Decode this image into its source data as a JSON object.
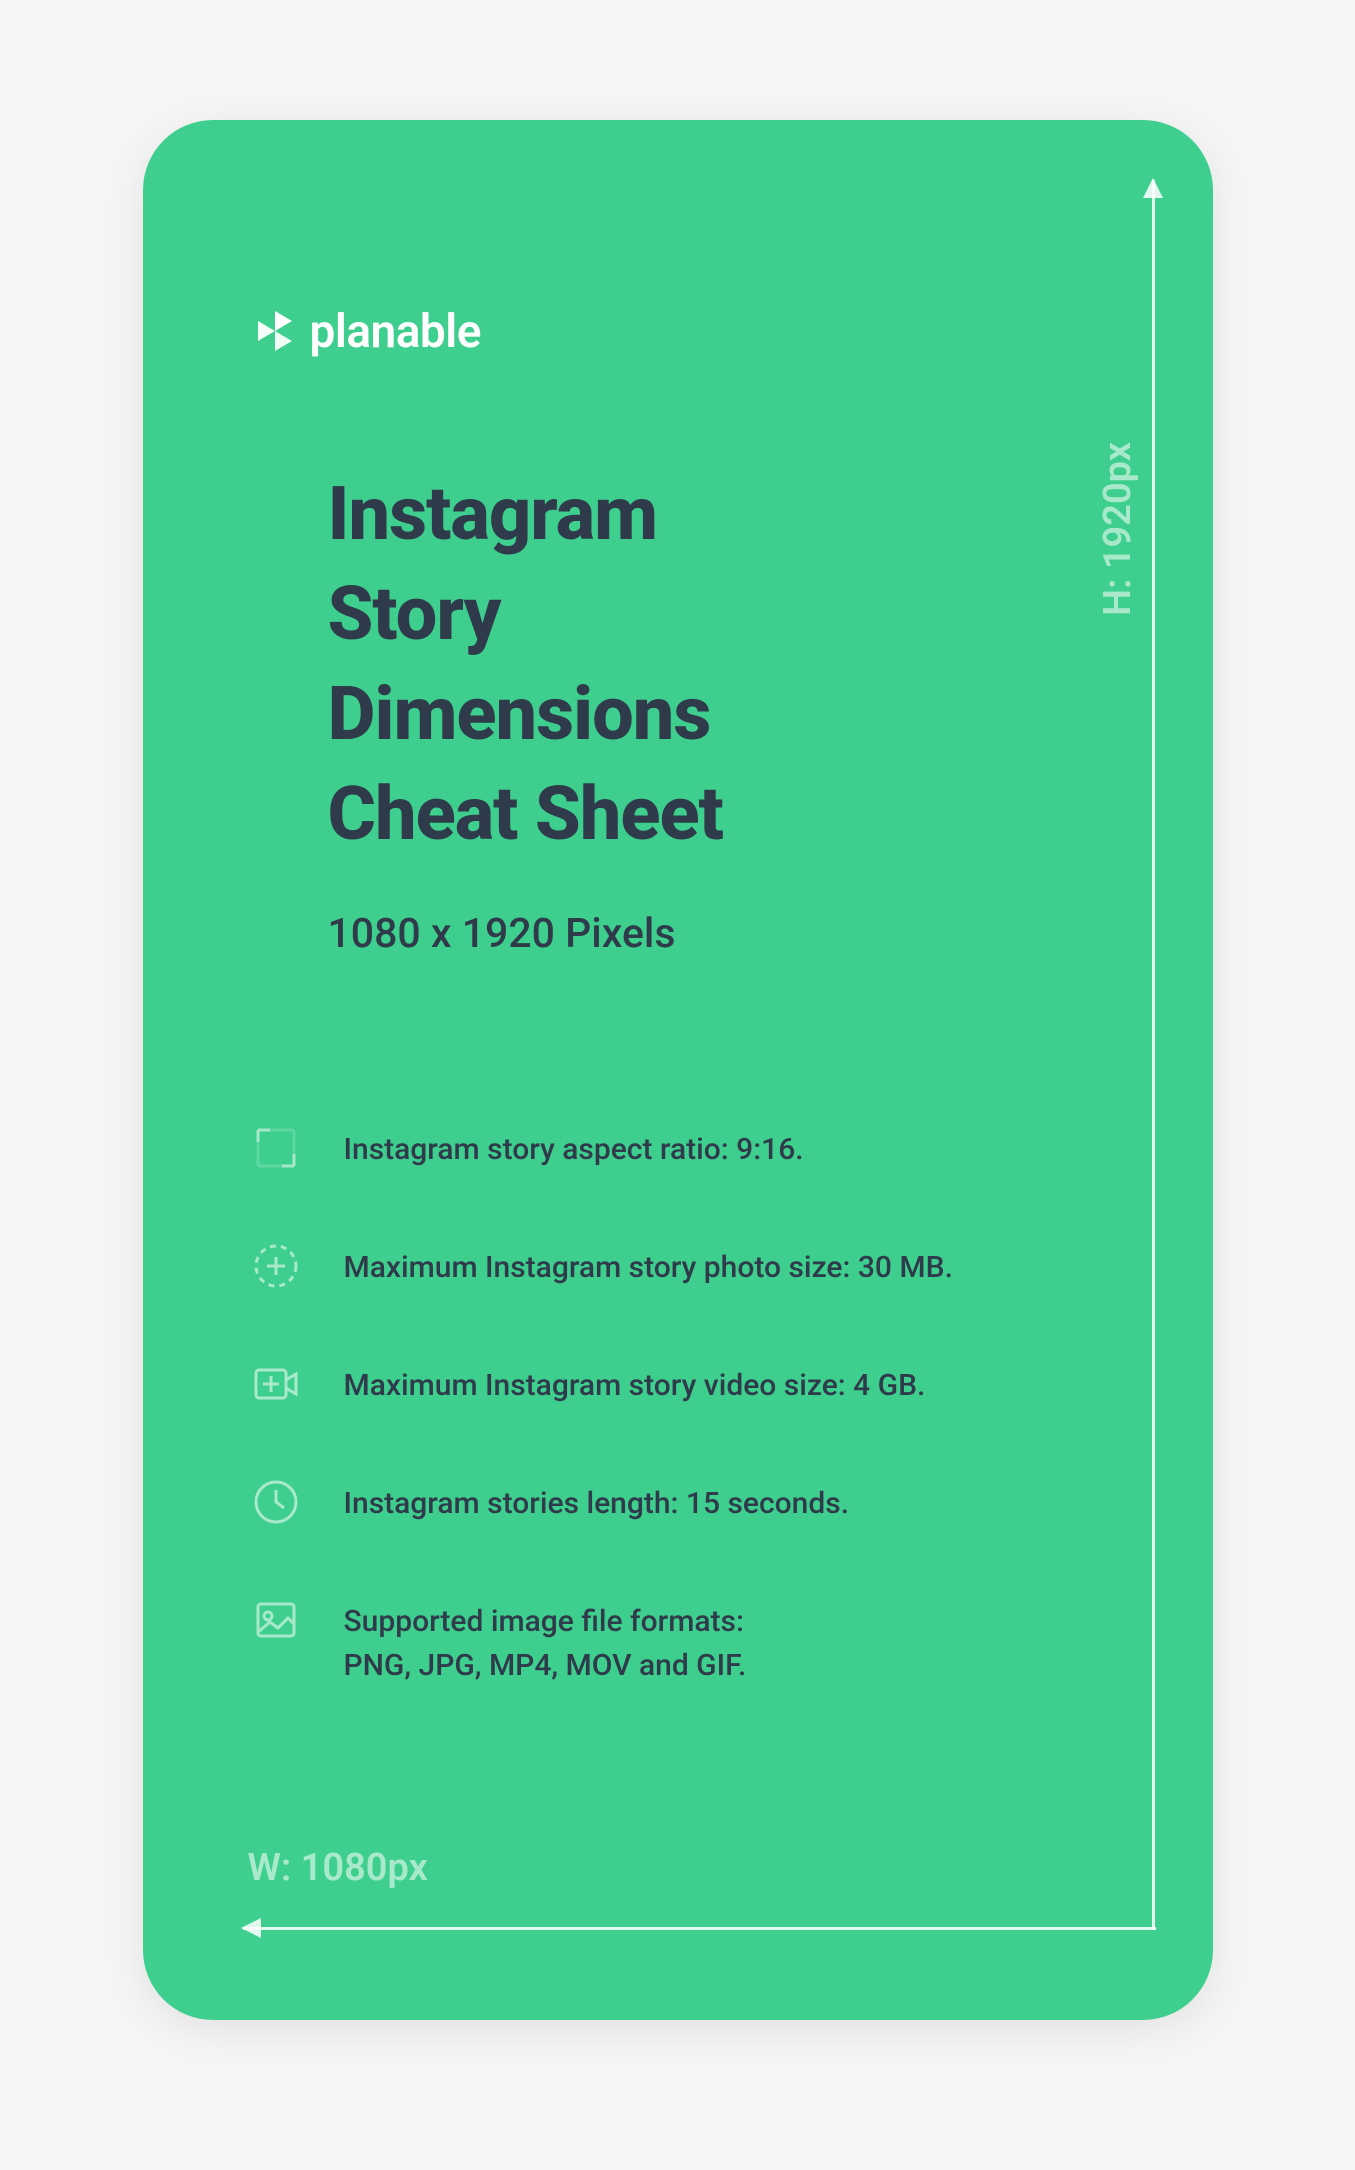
{
  "brand": "planable",
  "title_lines": "Instagram\nStory\nDimensions\nCheat Sheet",
  "subtitle": "1080 x 1920 Pixels",
  "height_label": "H: 1920px",
  "width_label": "W: 1080px",
  "specs": [
    {
      "icon": "aspect-ratio-icon",
      "text": "Instagram story aspect ratio: 9:16."
    },
    {
      "icon": "add-photo-icon",
      "text": "Maximum Instagram story photo size: 30 MB."
    },
    {
      "icon": "add-video-icon",
      "text": "Maximum Instagram story video size: 4 GB."
    },
    {
      "icon": "clock-icon",
      "text": "Instagram stories length: 15 seconds."
    },
    {
      "icon": "image-file-icon",
      "text": "Supported image file formats:\nPNG, JPG, MP4, MOV and GIF."
    }
  ]
}
